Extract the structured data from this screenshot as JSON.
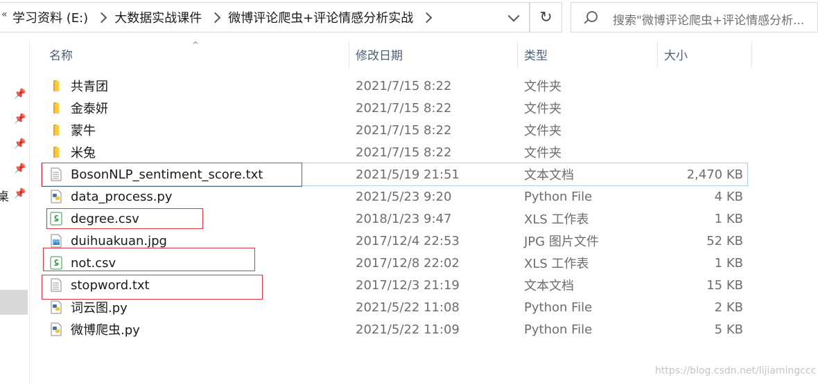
{
  "address_bar": {
    "lead": "«",
    "crumbs": [
      "学习资料 (E:)",
      "大数据实战课件",
      "微博评论爬虫+评论情感分析实战"
    ],
    "refresh_glyph": "↻"
  },
  "search": {
    "placeholder": "搜索\"微博评论爬虫+评论情感分析..."
  },
  "nav": {
    "desktop_label": "桌"
  },
  "columns": {
    "name": "名称",
    "date": "修改日期",
    "type": "类型",
    "size": "大小"
  },
  "files": [
    {
      "name": "共青团",
      "date": "2021/7/15 8:22",
      "type": "文件夹",
      "size": "",
      "icon": "folder-icon"
    },
    {
      "name": "金泰妍",
      "date": "2021/7/15 8:22",
      "type": "文件夹",
      "size": "",
      "icon": "folder-icon"
    },
    {
      "name": "蒙牛",
      "date": "2021/7/15 8:22",
      "type": "文件夹",
      "size": "",
      "icon": "folder-icon"
    },
    {
      "name": "米兔",
      "date": "2021/7/15 8:22",
      "type": "文件夹",
      "size": "",
      "icon": "folder-icon"
    },
    {
      "name": "BosonNLP_sentiment_score.txt",
      "date": "2021/5/19 21:51",
      "type": "文本文档",
      "size": "2,470 KB",
      "icon": "text-file-icon"
    },
    {
      "name": "data_process.py",
      "date": "2021/5/23 9:20",
      "type": "Python File",
      "size": "4 KB",
      "icon": "python-file-icon"
    },
    {
      "name": "degree.csv",
      "date": "2018/1/23 9:47",
      "type": "XLS 工作表",
      "size": "1 KB",
      "icon": "spreadsheet-file-icon"
    },
    {
      "name": "duihuakuan.jpg",
      "date": "2017/12/4 22:53",
      "type": "JPG 图片文件",
      "size": "52 KB",
      "icon": "image-file-icon"
    },
    {
      "name": "not.csv",
      "date": "2017/12/8 22:02",
      "type": "XLS 工作表",
      "size": "1 KB",
      "icon": "spreadsheet-file-icon"
    },
    {
      "name": "stopword.txt",
      "date": "2017/12/3 21:19",
      "type": "文本文档",
      "size": "15 KB",
      "icon": "text-file-icon"
    },
    {
      "name": "词云图.py",
      "date": "2021/5/22 11:08",
      "type": "Python File",
      "size": "2 KB",
      "icon": "python-file-icon"
    },
    {
      "name": "微博爬虫.py",
      "date": "2021/5/22 11:09",
      "type": "Python File",
      "size": "5 KB",
      "icon": "python-file-icon"
    }
  ],
  "highlighted_file": "BosonNLP_sentiment_score.txt",
  "annotation_color": "#e0333e",
  "watermark": "https://blog.csdn.net/lijiamingccc"
}
